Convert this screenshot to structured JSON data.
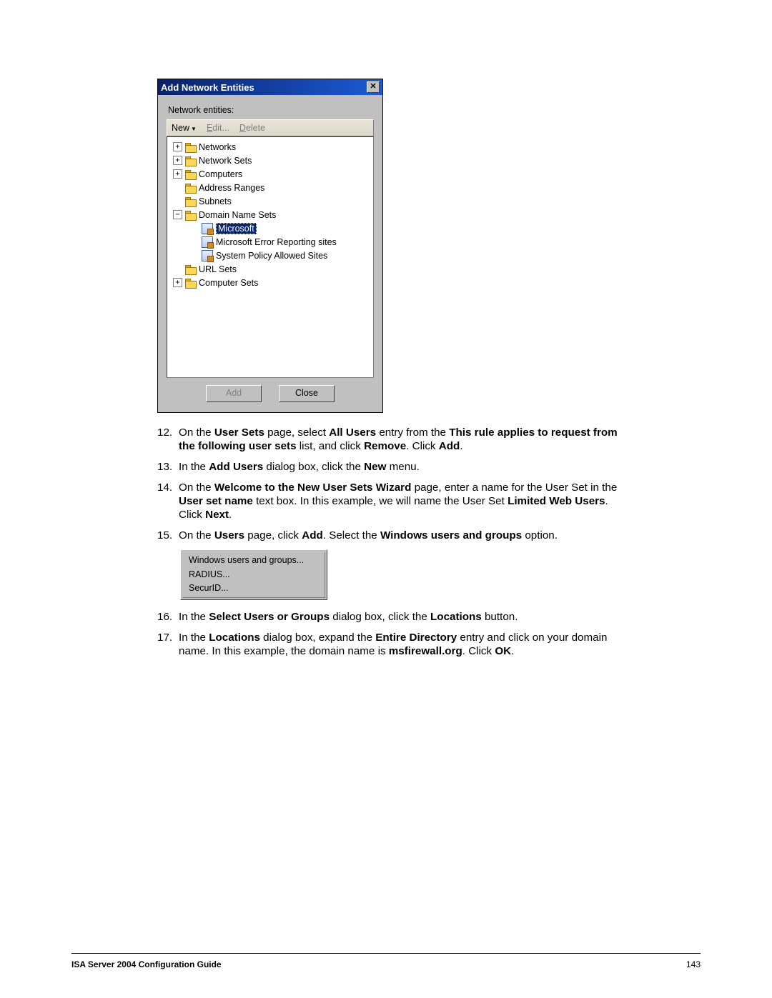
{
  "dialog": {
    "title": "Add Network Entities",
    "label": "Network entities:",
    "toolbar": {
      "new": "New",
      "edit": "Edit...",
      "delete": "Delete"
    },
    "tree": {
      "networks": "Networks",
      "networkSets": "Network Sets",
      "computers": "Computers",
      "addressRanges": "Address Ranges",
      "subnets": "Subnets",
      "domainNameSets": "Domain Name Sets",
      "microsoft": "Microsoft",
      "msError": "Microsoft Error Reporting sites",
      "sysPolicy": "System Policy Allowed Sites",
      "urlSets": "URL Sets",
      "computerSets": "Computer Sets"
    },
    "buttons": {
      "add": "Add",
      "close": "Close"
    }
  },
  "steps": {
    "s12": {
      "num": "12.",
      "html": "On the <b>User Sets</b> page, select <b>All Users</b> entry from the <b>This rule applies to request from the following user sets</b> list, and click <b>Remove</b>. Click <b>Add</b>."
    },
    "s13": {
      "num": "13.",
      "html": "In the <b>Add Users</b> dialog box, click the <b>New</b> menu."
    },
    "s14": {
      "num": "14.",
      "html": "On the <b>Welcome to the New User Sets Wizard</b> page, enter a name for the User Set in the <b>User set name</b> text box. In this example, we will name the User Set <b>Limited Web Users</b>. Click <b>Next</b>."
    },
    "s15": {
      "num": "15.",
      "html": "On the <b>Users</b> page, click <b>Add</b>. Select the <b>Windows users and groups</b> option."
    },
    "s16": {
      "num": "16.",
      "html": "In the <b>Select Users or Groups</b> dialog box, click the <b>Locations</b> button."
    },
    "s17": {
      "num": "17.",
      "html": "In the <b>Locations</b> dialog box, expand the <b>Entire Directory</b> entry and click on your domain name. In this example, the domain name is <b>msfirewall.org</b>. Click <b>OK</b>."
    }
  },
  "popup": {
    "windows": "Windows users and groups...",
    "radius": "RADIUS...",
    "securid": "SecurID..."
  },
  "footer": {
    "title": "ISA Server 2004 Configuration Guide",
    "page": "143"
  }
}
